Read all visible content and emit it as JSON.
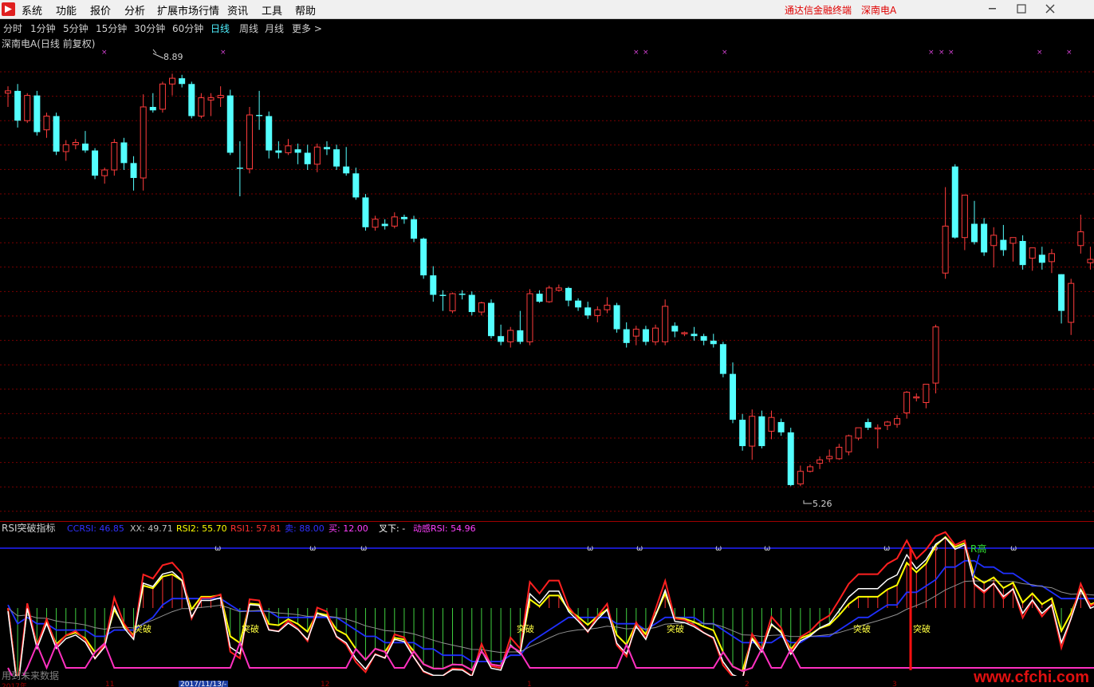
{
  "menu": {
    "items": [
      "系统",
      "功能",
      "报价",
      "分析",
      "扩展市场行情",
      "资讯",
      "工具",
      "帮助"
    ],
    "right_title": "通达信金融终端",
    "stock_name": "深南电A"
  },
  "periods": [
    "分时",
    "1分钟",
    "5分钟",
    "15分钟",
    "30分钟",
    "60分钟",
    "日线",
    "周线",
    "月线",
    "更多 >"
  ],
  "active_period": "日线",
  "main_chart": {
    "title": "深南电A(日线 前复权)",
    "high_label": "8.89",
    "low_label": "5.26",
    "y_range": [
      5.0,
      9.15
    ]
  },
  "indicator": {
    "name": "RSI突破指标",
    "values": [
      {
        "label": "CCRSI: 46.85",
        "color": "#3030ff"
      },
      {
        "label": "XX: 49.71",
        "color": "#c0c0c0"
      },
      {
        "label": "RSI2: 55.70",
        "color": "#ffff00"
      },
      {
        "label": "RSI1: 57.81",
        "color": "#ff3030"
      },
      {
        "label": "卖: 88.00",
        "color": "#3030ff"
      },
      {
        "label": "买: 12.00",
        "color": "#ff40ff"
      },
      {
        "label": "叉下: -",
        "color": "#ffffff"
      },
      {
        "label": "动感RSI: 54.96",
        "color": "#ff40ff"
      }
    ],
    "tupo_label": "突破",
    "rgao_label": "R高",
    "omega_label": "ω"
  },
  "footer": {
    "note": "用到未来数据",
    "dates": [
      "2017年",
      "11",
      "2017/11/13/-",
      "12",
      "1",
      "2",
      "3"
    ]
  },
  "watermark": "www.cfchi.com",
  "colors": {
    "up": "#ff3c3c",
    "down": "#54ffff",
    "grid": "#7a0000"
  },
  "chart_data": {
    "type": "candlestick",
    "candles": [
      [
        8.72,
        8.78,
        8.6,
        8.74
      ],
      [
        8.74,
        8.8,
        8.42,
        8.48
      ],
      [
        8.48,
        8.72,
        8.46,
        8.7
      ],
      [
        8.7,
        8.74,
        8.35,
        8.38
      ],
      [
        8.4,
        8.55,
        8.33,
        8.52
      ],
      [
        8.52,
        8.55,
        8.18,
        8.21
      ],
      [
        8.21,
        8.31,
        8.13,
        8.27
      ],
      [
        8.27,
        8.32,
        8.23,
        8.29
      ],
      [
        8.28,
        8.39,
        8.2,
        8.22
      ],
      [
        8.22,
        8.24,
        7.97,
        8.0
      ],
      [
        8.0,
        8.07,
        7.93,
        8.05
      ],
      [
        8.05,
        8.32,
        8.0,
        8.29
      ],
      [
        8.29,
        8.33,
        8.05,
        8.11
      ],
      [
        8.11,
        8.17,
        7.87,
        7.98
      ],
      [
        7.98,
        8.71,
        7.87,
        8.6
      ],
      [
        8.6,
        8.72,
        8.55,
        8.57
      ],
      [
        8.58,
        8.82,
        8.55,
        8.8
      ],
      [
        8.8,
        8.89,
        8.7,
        8.85
      ],
      [
        8.85,
        8.88,
        8.77,
        8.8
      ],
      [
        8.8,
        8.82,
        8.5,
        8.52
      ],
      [
        8.52,
        8.72,
        8.5,
        8.68
      ],
      [
        8.66,
        8.72,
        8.52,
        8.68
      ],
      [
        8.68,
        8.78,
        8.6,
        8.7
      ],
      [
        8.7,
        8.75,
        8.18,
        8.2
      ],
      [
        8.07,
        8.3,
        7.82,
        8.06
      ],
      [
        8.06,
        8.6,
        8.02,
        8.53
      ],
      [
        8.53,
        8.74,
        8.4,
        8.52
      ],
      [
        8.52,
        8.56,
        8.15,
        8.22
      ],
      [
        8.22,
        8.3,
        8.15,
        8.2
      ],
      [
        8.2,
        8.32,
        8.18,
        8.26
      ],
      [
        8.23,
        8.28,
        8.1,
        8.2
      ],
      [
        8.2,
        8.27,
        8.05,
        8.1
      ],
      [
        8.1,
        8.28,
        8.03,
        8.25
      ],
      [
        8.25,
        8.3,
        8.18,
        8.23
      ],
      [
        8.23,
        8.27,
        8.05,
        8.08
      ],
      [
        8.08,
        8.25,
        8.0,
        8.02
      ],
      [
        8.02,
        8.07,
        7.79,
        7.81
      ],
      [
        7.81,
        7.84,
        7.52,
        7.55
      ],
      [
        7.55,
        7.65,
        7.52,
        7.62
      ],
      [
        7.58,
        7.62,
        7.53,
        7.56
      ],
      [
        7.56,
        7.68,
        7.54,
        7.64
      ],
      [
        7.64,
        7.66,
        7.58,
        7.62
      ],
      [
        7.62,
        7.65,
        7.42,
        7.45
      ],
      [
        7.45,
        7.46,
        7.1,
        7.13
      ],
      [
        7.13,
        7.21,
        6.9,
        6.96
      ],
      [
        6.96,
        7.0,
        6.82,
        6.95
      ],
      [
        6.82,
        6.98,
        6.8,
        6.97
      ],
      [
        6.97,
        7.0,
        6.92,
        6.96
      ],
      [
        6.96,
        6.99,
        6.78,
        6.81
      ],
      [
        6.81,
        6.9,
        6.78,
        6.89
      ],
      [
        6.89,
        6.92,
        6.58,
        6.6
      ],
      [
        6.6,
        6.7,
        6.52,
        6.55
      ],
      [
        6.55,
        6.68,
        6.5,
        6.65
      ],
      [
        6.65,
        6.82,
        6.53,
        6.55
      ],
      [
        6.55,
        7.01,
        6.52,
        6.97
      ],
      [
        6.97,
        7.0,
        6.89,
        6.9
      ],
      [
        6.9,
        7.04,
        6.89,
        7.02
      ],
      [
        7.0,
        7.05,
        6.99,
        7.02
      ],
      [
        7.02,
        7.03,
        6.86,
        6.91
      ],
      [
        6.91,
        6.93,
        6.82,
        6.85
      ],
      [
        6.85,
        6.9,
        6.75,
        6.78
      ],
      [
        6.78,
        6.86,
        6.72,
        6.83
      ],
      [
        6.83,
        6.94,
        6.8,
        6.87
      ],
      [
        6.87,
        6.89,
        6.63,
        6.66
      ],
      [
        6.66,
        6.72,
        6.5,
        6.54
      ],
      [
        6.6,
        6.69,
        6.52,
        6.66
      ],
      [
        6.66,
        6.69,
        6.52,
        6.55
      ],
      [
        6.55,
        6.7,
        6.52,
        6.67
      ],
      [
        6.55,
        6.92,
        6.52,
        6.86
      ],
      [
        6.69,
        6.72,
        6.59,
        6.64
      ],
      [
        6.62,
        6.64,
        6.6,
        6.63
      ],
      [
        6.62,
        6.68,
        6.56,
        6.6
      ],
      [
        6.6,
        6.62,
        6.52,
        6.56
      ],
      [
        6.56,
        6.62,
        6.5,
        6.53
      ],
      [
        6.53,
        6.55,
        6.24,
        6.27
      ],
      [
        6.27,
        6.37,
        5.84,
        5.87
      ],
      [
        5.87,
        5.92,
        5.6,
        5.64
      ],
      [
        5.64,
        5.96,
        5.52,
        5.9
      ],
      [
        5.9,
        5.95,
        5.62,
        5.64
      ],
      [
        5.77,
        5.95,
        5.7,
        5.89
      ],
      [
        5.85,
        5.88,
        5.73,
        5.76
      ],
      [
        5.76,
        5.8,
        5.29,
        5.3
      ],
      [
        5.31,
        5.47,
        5.29,
        5.42
      ],
      [
        5.42,
        5.48,
        5.41,
        5.46
      ],
      [
        5.49,
        5.55,
        5.44,
        5.52
      ],
      [
        5.53,
        5.61,
        5.5,
        5.55
      ],
      [
        5.53,
        5.66,
        5.52,
        5.63
      ],
      [
        5.59,
        5.74,
        5.56,
        5.73
      ],
      [
        5.71,
        5.79,
        5.69,
        5.8
      ],
      [
        5.85,
        5.88,
        5.78,
        5.8
      ],
      [
        5.79,
        5.83,
        5.62,
        5.8
      ],
      [
        5.82,
        5.86,
        5.78,
        5.85
      ],
      [
        5.83,
        5.91,
        5.8,
        5.88
      ],
      [
        5.93,
        6.12,
        5.88,
        6.11
      ],
      [
        6.06,
        6.1,
        6.03,
        6.07
      ],
      [
        6.02,
        6.12,
        5.97,
        6.18
      ],
      [
        6.19,
        6.7,
        6.1,
        6.68
      ],
      [
        7.15,
        7.9,
        7.1,
        7.56
      ],
      [
        8.08,
        8.1,
        7.45,
        7.46
      ],
      [
        7.46,
        7.82,
        7.35,
        7.83
      ],
      [
        7.58,
        7.78,
        7.4,
        7.42
      ],
      [
        7.58,
        7.63,
        7.3,
        7.33
      ],
      [
        7.39,
        7.55,
        7.2,
        7.48
      ],
      [
        7.44,
        7.57,
        7.3,
        7.35
      ],
      [
        7.41,
        7.44,
        7.25,
        7.46
      ],
      [
        7.43,
        7.48,
        7.18,
        7.22
      ],
      [
        7.28,
        7.36,
        7.17,
        7.37
      ],
      [
        7.31,
        7.38,
        7.18,
        7.24
      ],
      [
        7.25,
        7.36,
        7.15,
        7.32
      ],
      [
        7.14,
        7.14,
        6.71,
        6.82
      ],
      [
        6.72,
        7.1,
        6.61,
        7.06
      ],
      [
        7.39,
        7.66,
        7.32,
        7.51
      ],
      [
        7.24,
        7.38,
        7.18,
        7.27
      ],
      [
        7.24,
        7.43,
        7.18,
        7.33
      ]
    ]
  }
}
